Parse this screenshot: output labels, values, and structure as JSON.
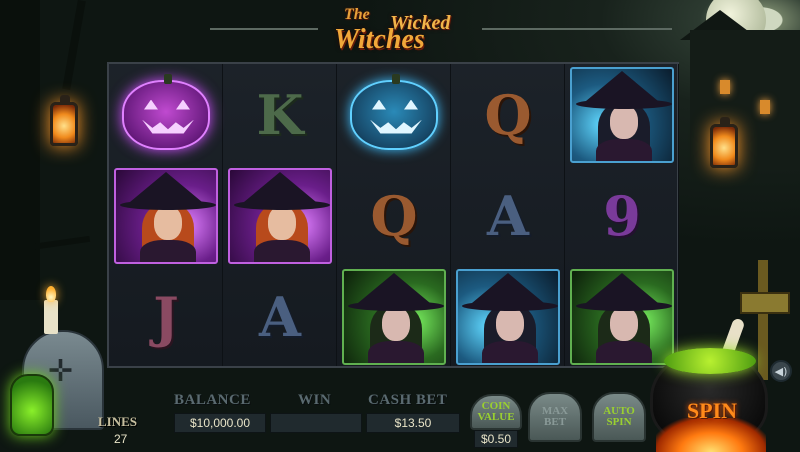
{
  "logo": {
    "line1": "The",
    "line2": "Wicked",
    "line3": "Witches"
  },
  "reels": [
    {
      "cells": [
        {
          "type": "pumpkin",
          "variant": "purple"
        },
        {
          "type": "witch",
          "variant": "purple"
        },
        {
          "type": "letter",
          "glyph": "J",
          "variant": "j"
        }
      ]
    },
    {
      "cells": [
        {
          "type": "letter",
          "glyph": "K",
          "variant": "k"
        },
        {
          "type": "witch",
          "variant": "purple"
        },
        {
          "type": "letter",
          "glyph": "A",
          "variant": "a"
        }
      ]
    },
    {
      "cells": [
        {
          "type": "pumpkin",
          "variant": "blue"
        },
        {
          "type": "letter",
          "glyph": "Q",
          "variant": "q"
        },
        {
          "type": "witch",
          "variant": "green"
        }
      ]
    },
    {
      "cells": [
        {
          "type": "letter",
          "glyph": "Q",
          "variant": "q"
        },
        {
          "type": "letter",
          "glyph": "A",
          "variant": "a"
        },
        {
          "type": "witch",
          "variant": "blue"
        }
      ]
    },
    {
      "cells": [
        {
          "type": "witch",
          "variant": "blue"
        },
        {
          "type": "letter",
          "glyph": "9",
          "variant": "nine"
        },
        {
          "type": "witch",
          "variant": "green"
        }
      ]
    }
  ],
  "panel": {
    "lines_label": "LINES",
    "lines_value": "27",
    "balance_label": "BALANCE",
    "balance_value": "$10,000.00",
    "win_label": "WIN",
    "win_value": "",
    "cashbet_label": "CASH BET",
    "cashbet_value": "$13.50",
    "coin_value_label": "COIN VALUE",
    "coin_value": "$0.50",
    "max_bet_label": "MAX BET",
    "auto_spin_label": "AUTO SPIN",
    "spin_label": "SPIN",
    "sound_icon": "speaker-icon"
  },
  "colors": {
    "spin": "#ff8a1a",
    "label": "#5a6a70",
    "accent_green": "#9ad030"
  }
}
